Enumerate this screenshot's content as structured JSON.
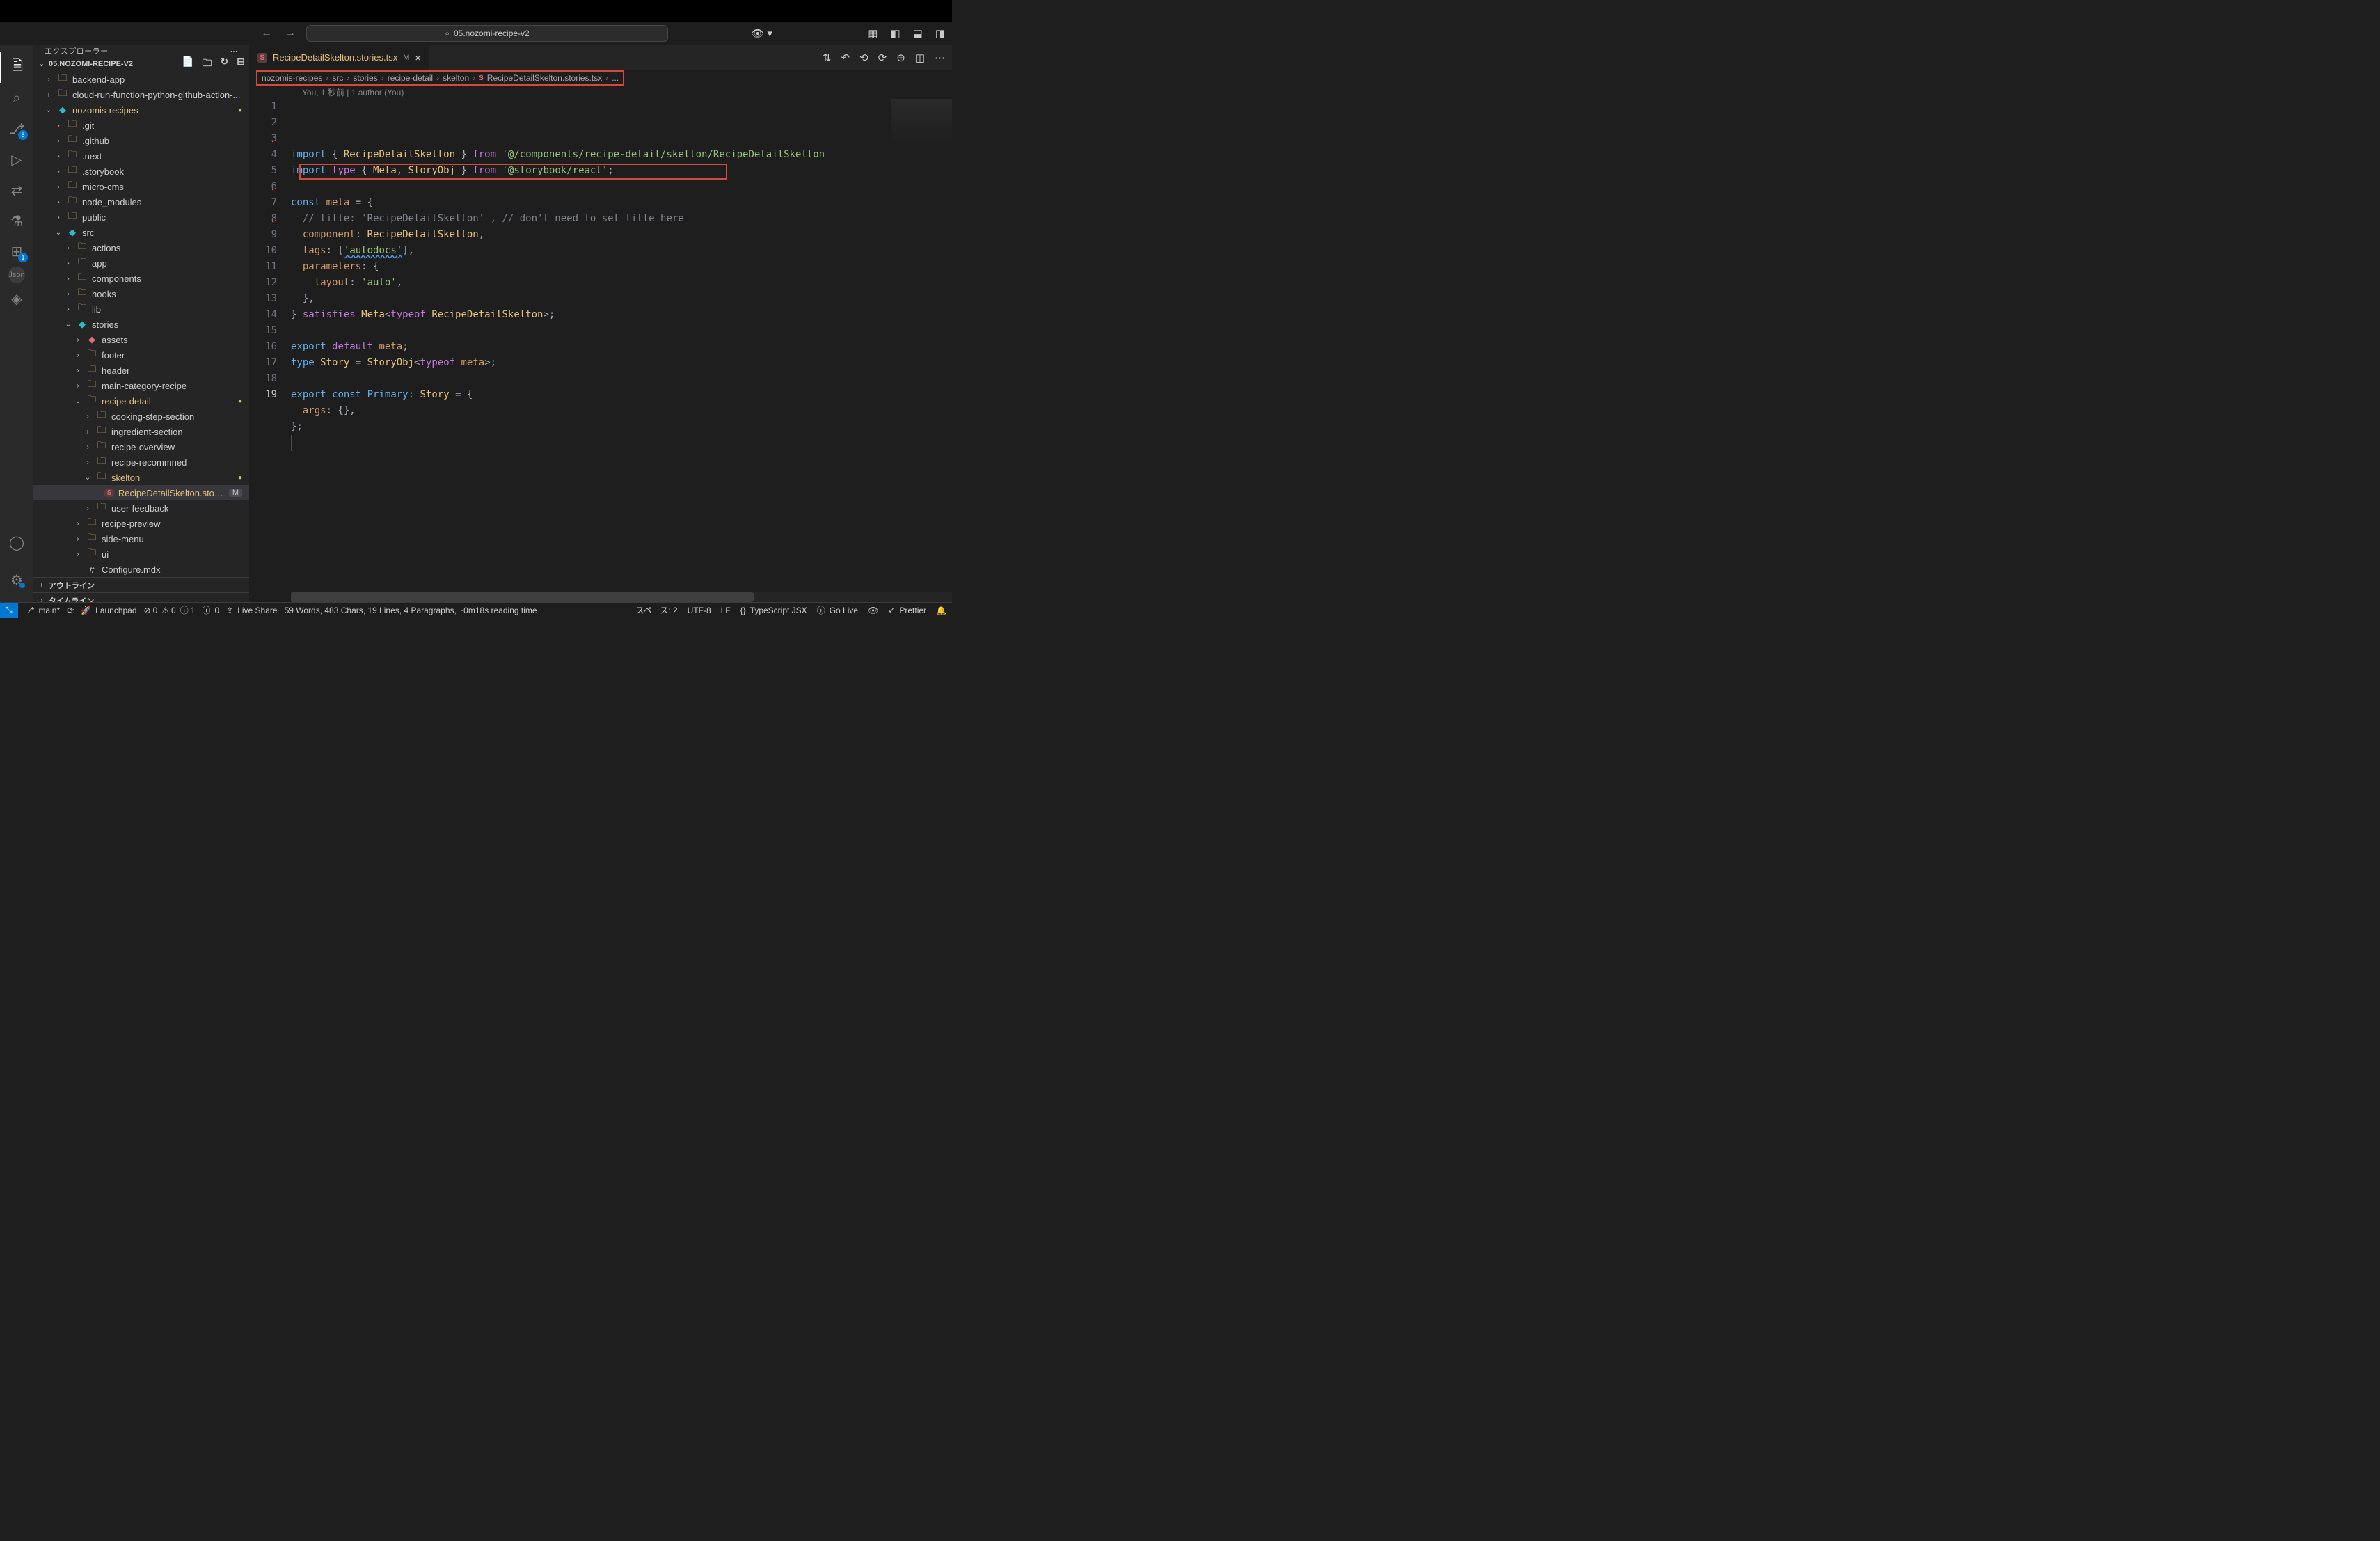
{
  "titlebar": {
    "search_text": "05.nozomi-recipe-v2"
  },
  "activity": {
    "scm_badge": "8",
    "ext_badge": "1"
  },
  "sidebar": {
    "title": "エクスプローラー",
    "project": "05.NOZOMI-RECIPE-V2",
    "tree": [
      {
        "t": "folder",
        "lbl": "backend-app",
        "pad": 1,
        "open": false,
        "chev": "›"
      },
      {
        "t": "folder",
        "lbl": "cloud-run-function-python-github-action-...",
        "pad": 1,
        "open": false,
        "chev": "›"
      },
      {
        "t": "folder",
        "lbl": "nozomis-recipes",
        "pad": 1,
        "open": true,
        "chev": "⌄",
        "teal": true,
        "mod": "dot",
        "dim": true
      },
      {
        "t": "folder",
        "lbl": ".git",
        "pad": 2,
        "open": false,
        "chev": "›"
      },
      {
        "t": "folder",
        "lbl": ".github",
        "pad": 2,
        "open": false,
        "chev": "›"
      },
      {
        "t": "folder",
        "lbl": ".next",
        "pad": 2,
        "open": false,
        "chev": "›"
      },
      {
        "t": "folder",
        "lbl": ".storybook",
        "pad": 2,
        "open": false,
        "chev": "›"
      },
      {
        "t": "folder",
        "lbl": "micro-cms",
        "pad": 2,
        "open": false,
        "chev": "›"
      },
      {
        "t": "folder",
        "lbl": "node_modules",
        "pad": 2,
        "open": false,
        "chev": "›"
      },
      {
        "t": "folder",
        "lbl": "public",
        "pad": 2,
        "open": false,
        "chev": "›"
      },
      {
        "t": "folder",
        "lbl": "src",
        "pad": 2,
        "open": true,
        "chev": "⌄",
        "teal": true
      },
      {
        "t": "folder",
        "lbl": "actions",
        "pad": 3,
        "open": false,
        "chev": "›"
      },
      {
        "t": "folder",
        "lbl": "app",
        "pad": 3,
        "open": false,
        "chev": "›"
      },
      {
        "t": "folder",
        "lbl": "components",
        "pad": 3,
        "open": false,
        "chev": "›"
      },
      {
        "t": "folder",
        "lbl": "hooks",
        "pad": 3,
        "open": false,
        "chev": "›"
      },
      {
        "t": "folder",
        "lbl": "lib",
        "pad": 3,
        "open": false,
        "chev": "›"
      },
      {
        "t": "folder",
        "lbl": "stories",
        "pad": 3,
        "open": true,
        "chev": "⌄",
        "teal": true
      },
      {
        "t": "folder",
        "lbl": "assets",
        "pad": 4,
        "open": false,
        "chev": "›",
        "red": true
      },
      {
        "t": "folder",
        "lbl": "footer",
        "pad": 4,
        "open": false,
        "chev": "›"
      },
      {
        "t": "folder",
        "lbl": "header",
        "pad": 4,
        "open": false,
        "chev": "›"
      },
      {
        "t": "folder",
        "lbl": "main-category-recipe",
        "pad": 4,
        "open": false,
        "chev": "›"
      },
      {
        "t": "folder",
        "lbl": "recipe-detail",
        "pad": 4,
        "open": true,
        "chev": "⌄",
        "dim": true,
        "mod": "dot"
      },
      {
        "t": "folder",
        "lbl": "cooking-step-section",
        "pad": 5,
        "open": false,
        "chev": "›"
      },
      {
        "t": "folder",
        "lbl": "ingredient-section",
        "pad": 5,
        "open": false,
        "chev": "›"
      },
      {
        "t": "folder",
        "lbl": "recipe-overview",
        "pad": 5,
        "open": false,
        "chev": "›"
      },
      {
        "t": "folder",
        "lbl": "recipe-recommned",
        "pad": 5,
        "open": false,
        "chev": "›"
      },
      {
        "t": "folder",
        "lbl": "skelton",
        "pad": 5,
        "open": true,
        "chev": "⌄",
        "dim": true,
        "mod": "dot"
      },
      {
        "t": "file",
        "lbl": "RecipeDetailSkelton.stories.tsx",
        "pad": 6,
        "selected": true,
        "mod": "M",
        "dim": true,
        "ficon": "S"
      },
      {
        "t": "folder",
        "lbl": "user-feedback",
        "pad": 5,
        "open": false,
        "chev": "›"
      },
      {
        "t": "folder",
        "lbl": "recipe-preview",
        "pad": 4,
        "open": false,
        "chev": "›"
      },
      {
        "t": "folder",
        "lbl": "side-menu",
        "pad": 4,
        "open": false,
        "chev": "›"
      },
      {
        "t": "folder",
        "lbl": "ui",
        "pad": 4,
        "open": false,
        "chev": "›"
      },
      {
        "t": "file",
        "lbl": "Configure.mdx",
        "pad": 4,
        "ficon": "#",
        "white": true
      }
    ],
    "outline": "アウトライン",
    "timeline": "タイムライン"
  },
  "tab": {
    "label": "RecipeDetailSkelton.stories.tsx",
    "status": "M"
  },
  "breadcrumbs": [
    "nozomis-recipes",
    "src",
    "stories",
    "recipe-detail",
    "skelton",
    "RecipeDetailSkelton.stories.tsx",
    "..."
  ],
  "codelens": "You, 1 秒前 | 1 author (You)",
  "code": {
    "lines": [
      {
        "n": 1,
        "spans": [
          [
            "k-import",
            "import"
          ],
          [
            "sym",
            " { "
          ],
          [
            "name",
            "RecipeDetailSkelton"
          ],
          [
            "sym",
            " } "
          ],
          [
            "k-from",
            "from"
          ],
          [
            "sym",
            " "
          ],
          [
            "str",
            "'@/components/recipe-detail/skelton/RecipeDetailSkelton"
          ]
        ]
      },
      {
        "n": 2,
        "spans": [
          [
            "k-import",
            "import"
          ],
          [
            "sym",
            " "
          ],
          [
            "kw2",
            "type"
          ],
          [
            "sym",
            " { "
          ],
          [
            "name",
            "Meta"
          ],
          [
            "sym",
            ", "
          ],
          [
            "name",
            "StoryObj"
          ],
          [
            "sym",
            " } "
          ],
          [
            "k-from",
            "from"
          ],
          [
            "sym",
            " "
          ],
          [
            "str",
            "'@storybook/react'"
          ],
          [
            "sym",
            ";"
          ]
        ]
      },
      {
        "n": 3,
        "spans": [
          [
            "sym",
            ""
          ]
        ],
        "fold": true
      },
      {
        "n": 4,
        "spans": [
          [
            "k-const",
            "const"
          ],
          [
            "sym",
            " "
          ],
          [
            "prop",
            "meta"
          ],
          [
            "sym",
            " = {"
          ]
        ]
      },
      {
        "n": 5,
        "spans": [
          [
            "sym",
            "  "
          ],
          [
            "comment",
            "// title: 'RecipeDetailSkelton' , // don't need to set title here"
          ]
        ]
      },
      {
        "n": 6,
        "spans": [
          [
            "sym",
            "  "
          ],
          [
            "prop",
            "component"
          ],
          [
            "sym",
            ": "
          ],
          [
            "name",
            "RecipeDetailSkelton"
          ],
          [
            "sym",
            ","
          ]
        ],
        "fold": true
      },
      {
        "n": 7,
        "spans": [
          [
            "sym",
            "  "
          ],
          [
            "prop",
            "tags"
          ],
          [
            "sym",
            ": ["
          ],
          [
            "str",
            "'",
            "wave"
          ],
          [
            "str",
            "autodocs",
            "wave"
          ],
          [
            "str",
            "'",
            "wave"
          ],
          [
            "sym",
            "],"
          ]
        ]
      },
      {
        "n": 8,
        "spans": [
          [
            "sym",
            "  "
          ],
          [
            "prop",
            "parameters"
          ],
          [
            "sym",
            ": {"
          ]
        ],
        "fold": true
      },
      {
        "n": 9,
        "spans": [
          [
            "sym",
            "    "
          ],
          [
            "prop",
            "layout"
          ],
          [
            "sym",
            ": "
          ],
          [
            "str",
            "'auto'"
          ],
          [
            "sym",
            ","
          ]
        ]
      },
      {
        "n": 10,
        "spans": [
          [
            "sym",
            "  },"
          ]
        ]
      },
      {
        "n": 11,
        "spans": [
          [
            "sym",
            "} "
          ],
          [
            "kw2",
            "satisfies"
          ],
          [
            "sym",
            " "
          ],
          [
            "name",
            "Meta"
          ],
          [
            "sym",
            "<"
          ],
          [
            "kw2",
            "typeof"
          ],
          [
            "sym",
            " "
          ],
          [
            "name",
            "RecipeDetailSkelton"
          ],
          [
            "sym",
            ">;"
          ]
        ]
      },
      {
        "n": 12,
        "spans": [
          [
            "sym",
            ""
          ]
        ]
      },
      {
        "n": 13,
        "spans": [
          [
            "k-import",
            "export"
          ],
          [
            "sym",
            " "
          ],
          [
            "kw2",
            "default"
          ],
          [
            "sym",
            " "
          ],
          [
            "prop",
            "meta"
          ],
          [
            "sym",
            ";"
          ]
        ]
      },
      {
        "n": 14,
        "spans": [
          [
            "k-const",
            "type"
          ],
          [
            "sym",
            " "
          ],
          [
            "name",
            "Story"
          ],
          [
            "sym",
            " = "
          ],
          [
            "name",
            "StoryObj"
          ],
          [
            "sym",
            "<"
          ],
          [
            "kw2",
            "typeof"
          ],
          [
            "sym",
            " "
          ],
          [
            "prop",
            "meta"
          ],
          [
            "sym",
            ">;"
          ]
        ]
      },
      {
        "n": 15,
        "spans": [
          [
            "sym",
            ""
          ]
        ]
      },
      {
        "n": 16,
        "spans": [
          [
            "k-import",
            "export"
          ],
          [
            "sym",
            " "
          ],
          [
            "k-const",
            "const"
          ],
          [
            "sym",
            " "
          ],
          [
            "fn",
            "Primary"
          ],
          [
            "sym",
            ": "
          ],
          [
            "name",
            "Story"
          ],
          [
            "sym",
            " = {"
          ]
        ]
      },
      {
        "n": 17,
        "spans": [
          [
            "sym",
            "  "
          ],
          [
            "prop",
            "args"
          ],
          [
            "sym",
            ": {},"
          ]
        ]
      },
      {
        "n": 18,
        "spans": [
          [
            "sym",
            "};"
          ]
        ]
      },
      {
        "n": 19,
        "spans": [
          [
            "sym",
            ""
          ]
        ],
        "active": true
      }
    ]
  },
  "status": {
    "branch": "main*",
    "sync": "⟳",
    "launchpad": "Launchpad",
    "errors": "0",
    "warnings": "0",
    "info": "1",
    "radio": "0",
    "live_share": "Live Share",
    "stats": "59 Words, 483 Chars, 19 Lines, 4 Paragraphs, ~0m18s reading time",
    "spaces": "スペース: 2",
    "encoding": "UTF-8",
    "eol": "LF",
    "lang": "TypeScript JSX",
    "golive": "Go Live",
    "prettier": "Prettier"
  }
}
